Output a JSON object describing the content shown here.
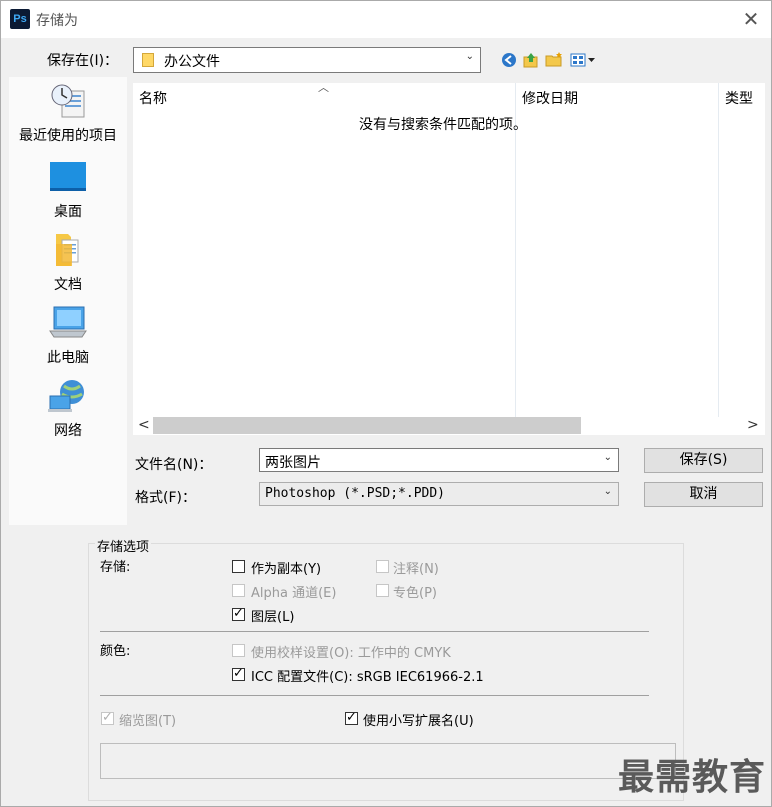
{
  "window": {
    "title": "存储为",
    "app_icon": "Ps"
  },
  "save_in": {
    "label": "保存在(I)：",
    "folder": "办公文件"
  },
  "toolbar": {
    "icons": [
      "back-icon",
      "up-folder-icon",
      "new-folder-icon",
      "view-menu-icon"
    ]
  },
  "places": [
    {
      "label": "最近使用的项目",
      "icon": "recent-items-icon"
    },
    {
      "label": "桌面",
      "icon": "desktop-icon"
    },
    {
      "label": "文档",
      "icon": "documents-icon"
    },
    {
      "label": "此电脑",
      "icon": "this-pc-icon"
    },
    {
      "label": "网络",
      "icon": "network-icon"
    }
  ],
  "file_list": {
    "columns": [
      "名称",
      "修改日期",
      "类型"
    ],
    "empty_message": "没有与搜索条件匹配的项。"
  },
  "filename": {
    "label": "文件名(N)：",
    "value": "两张图片"
  },
  "format": {
    "label": "格式(F)：",
    "value": "Photoshop (*.PSD;*.PDD)"
  },
  "buttons": {
    "save": "保存(S)",
    "cancel": "取消"
  },
  "options": {
    "group_title": "存储选项",
    "storage_label": "存储:",
    "as_copy": "作为副本(Y)",
    "annotations": "注释(N)",
    "alpha_channels": "Alpha 通道(E)",
    "spot_colors": "专色(P)",
    "layers": "图层(L)",
    "color_label": "颜色:",
    "use_proof_setup": "使用校样设置(O): 工作中的 CMYK",
    "icc_profile": "ICC 配置文件(C): sRGB IEC61966-2.1",
    "thumbnail": "缩览图(T)",
    "lowercase_ext": "使用小写扩展名(U)"
  },
  "watermark": "最需教育"
}
